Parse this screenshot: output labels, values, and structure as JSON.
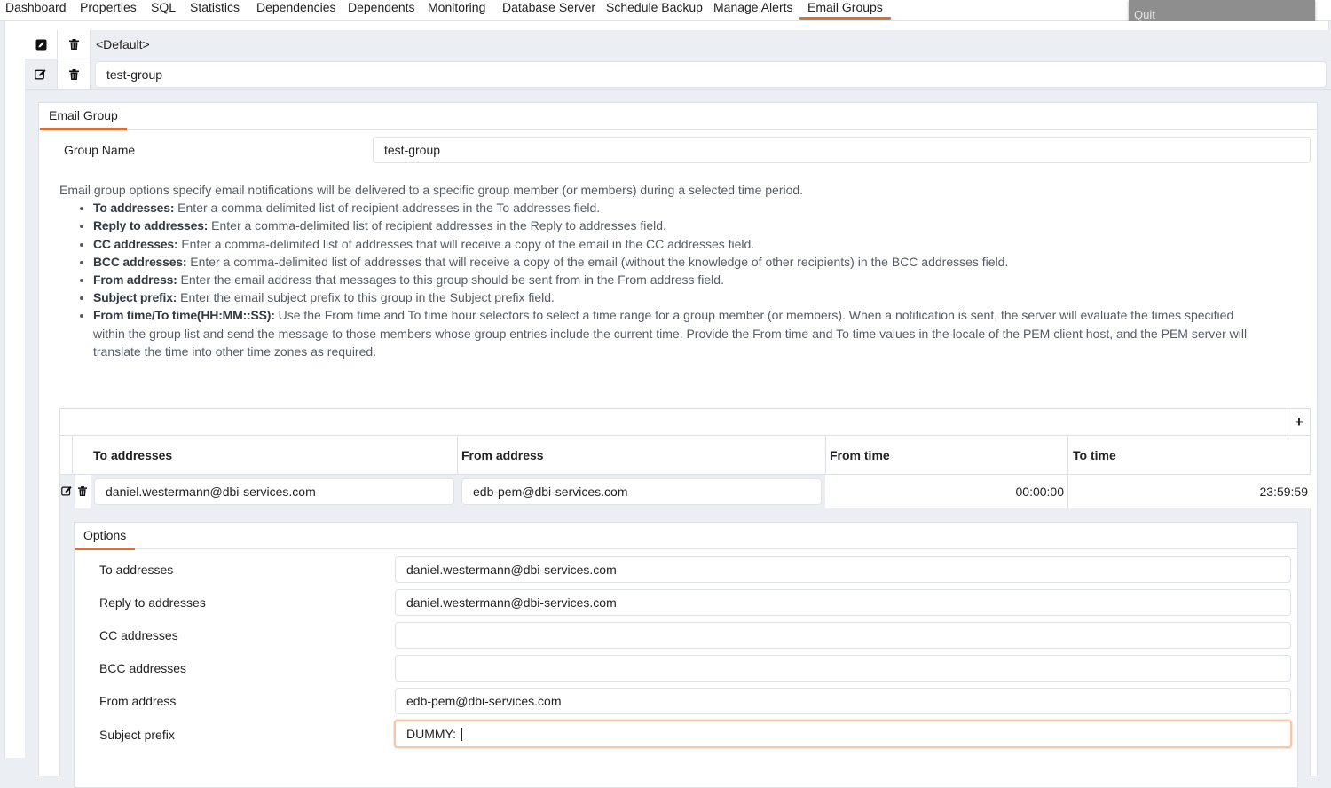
{
  "tabs": [
    "Dashboard",
    "Properties",
    "SQL",
    "Statistics",
    "Dependencies",
    "Dependents",
    "Monitoring",
    "Database Server",
    "Schedule Backup",
    "Manage Alerts",
    "Email Groups"
  ],
  "active_tab": "Email Groups",
  "quit_label": "Quit",
  "groups": [
    {
      "name": "<Default>"
    },
    {
      "name": "test-group"
    }
  ],
  "email_group": {
    "tab_label": "Email Group",
    "group_name_label": "Group Name",
    "group_name_value": "test-group",
    "help_intro": "Email group options specify email notifications will be delivered to a specific group member (or members) during a selected time period.",
    "help_items": [
      {
        "term": "To addresses:",
        "text": " Enter a comma-delimited list of recipient addresses in the To addresses field."
      },
      {
        "term": "Reply to addresses:",
        "text": " Enter a comma-delimited list of recipient addresses in the Reply to addresses field."
      },
      {
        "term": "CC addresses:",
        "text": " Enter a comma-delimited list of addresses that will receive a copy of the email in the CC addresses field."
      },
      {
        "term": "BCC addresses:",
        "text": " Enter a comma-delimited list of addresses that will receive a copy of the email (without the knowledge of other recipients) in the BCC addresses field."
      },
      {
        "term": "From address:",
        "text": " Enter the email address that messages to this group should be sent from in the From address field."
      },
      {
        "term": "Subject prefix:",
        "text": " Enter the email subject prefix to this group in the Subject prefix field."
      },
      {
        "term": "From time/To time(HH:MM::SS):",
        "text": " Use the From time and To time hour selectors to select a time range for a group member (or members). When a notification is sent, the server will evaluate the times specified within the group list and send the message to those members whose group entries include the current time. Provide the From time and To time values in the locale of the PEM client host, and the PEM server will translate the time into other time zones as required."
      }
    ]
  },
  "members_grid": {
    "add_label": "+",
    "columns": [
      "To addresses",
      "From address",
      "From time",
      "To time"
    ],
    "rows": [
      {
        "to": "daniel.westermann@dbi-services.com",
        "from": "edb-pem@dbi-services.com",
        "from_time": "00:00:00",
        "to_time": "23:59:59"
      }
    ]
  },
  "options": {
    "tab_label": "Options",
    "fields": [
      {
        "label": "To addresses",
        "value": "daniel.westermann@dbi-services.com"
      },
      {
        "label": "Reply to addresses",
        "value": "daniel.westermann@dbi-services.com"
      },
      {
        "label": "CC addresses",
        "value": ""
      },
      {
        "label": "BCC addresses",
        "value": ""
      },
      {
        "label": "From address",
        "value": "edb-pem@dbi-services.com"
      },
      {
        "label": "Subject prefix",
        "value": "DUMMY: "
      }
    ]
  },
  "colors": {
    "accent": "#e06d2d",
    "background": "#ebeef3",
    "border": "#dde0e6"
  }
}
